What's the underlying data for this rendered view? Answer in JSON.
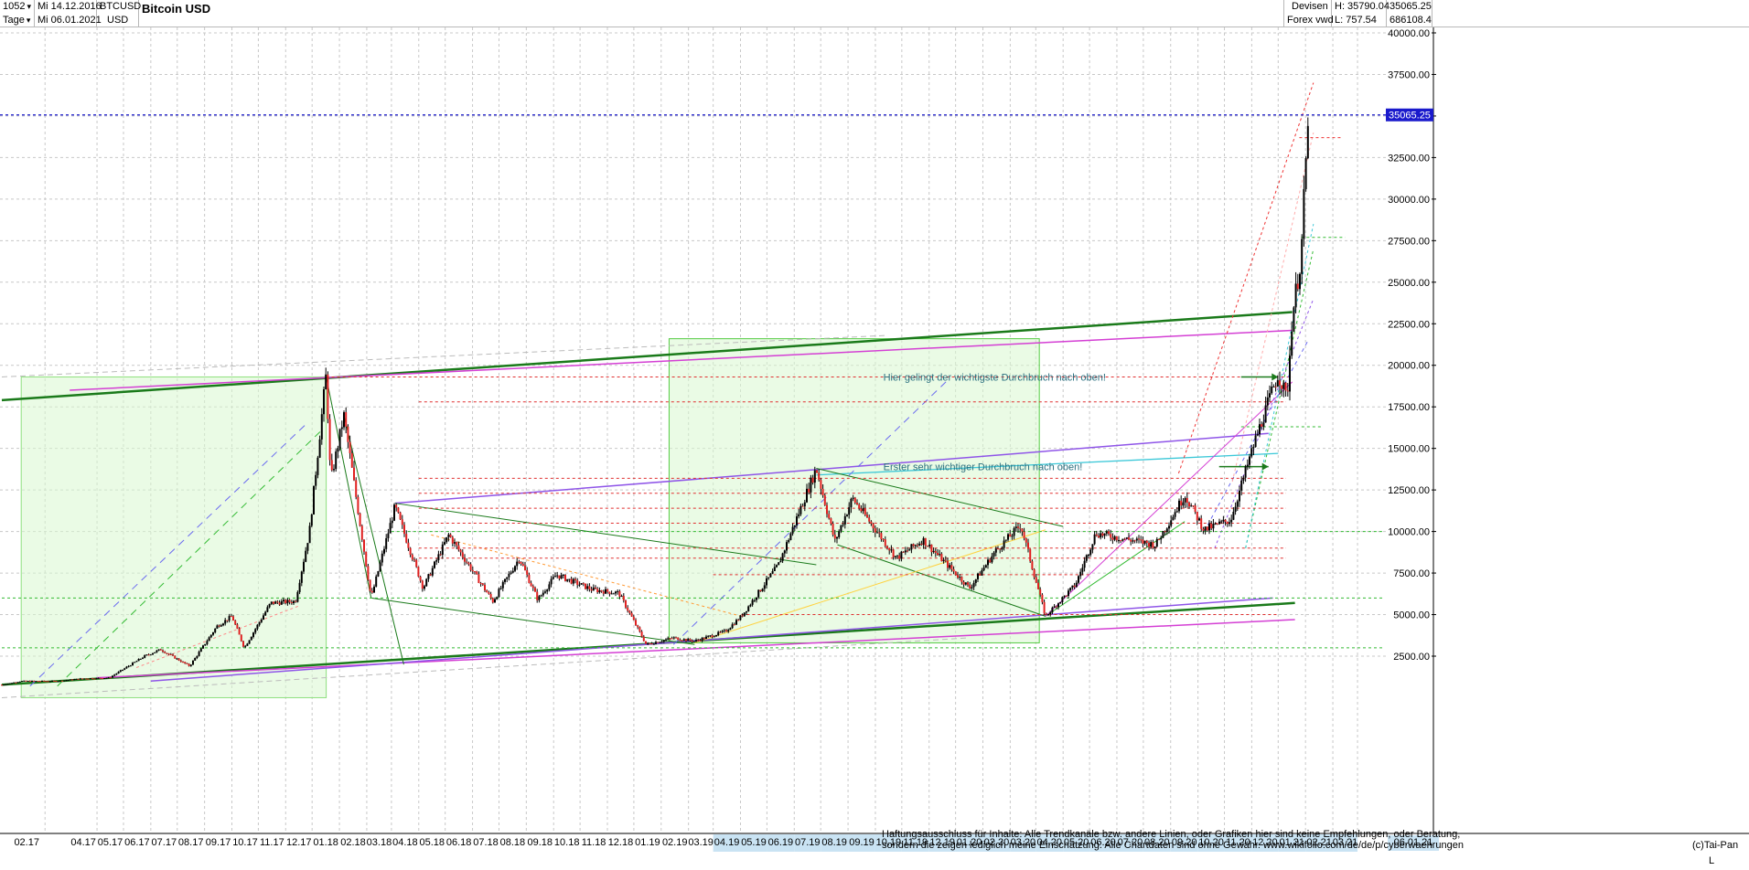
{
  "header": {
    "bars_count": "1052",
    "interval": "Tage",
    "date_from": "Mi 14.12.2016",
    "date_to": "Mi 06.01.2021",
    "symbol": "BTCUSD",
    "currency": "USD",
    "title": "Bitcoin USD",
    "market": "Devisen",
    "source": "Forex vwd",
    "high": "H: 35790.04",
    "low": "L: 757.54",
    "last": "35065.25",
    "volume": "686108.4"
  },
  "chart_data": {
    "type": "candlestick",
    "title": "Bitcoin USD",
    "ylim": [
      0,
      41000
    ],
    "y_ticks": [
      2500,
      5000,
      7500,
      10000,
      12500,
      15000,
      17500,
      20000,
      22500,
      25000,
      27500,
      30000,
      32500,
      35000,
      37500,
      40000
    ],
    "y_tick_labels": [
      "2500.00",
      "5000.00",
      "7500.00",
      "10000.00",
      "12500.00",
      "15000.00",
      "17500.00",
      "20000.00",
      "22500.00",
      "25000.00",
      "27500.00",
      "30000.00",
      "32500.00",
      "35000.00",
      "37500.00",
      "40000.00"
    ],
    "x_tick_labels": [
      "02.17",
      "04.17",
      "05.17",
      "06.17",
      "07.17",
      "08.17",
      "09.17",
      "10.17",
      "11.17",
      "12.17",
      "01.18",
      "02.18",
      "03.18",
      "04.18",
      "05.18",
      "06.18",
      "07.18",
      "08.18",
      "09.18",
      "10.18",
      "11.18",
      "12.18",
      "01.19",
      "02.19",
      "03.19",
      "04.19",
      "05.19",
      "06.19",
      "07.19",
      "08.19",
      "09.19",
      "10.19",
      "11.19",
      "12.19",
      "01.20",
      "02.20",
      "03.20",
      "04.20",
      "05.20",
      "06.20",
      "07.20",
      "08.20",
      "09.20",
      "10.20",
      "11.20",
      "12.20",
      "01.21",
      "02.21",
      "03.21"
    ],
    "last_date_label": "06.01.21",
    "last_price_label": "35065.25",
    "price_path": [
      [
        "2016-12-14",
        780
      ],
      [
        "2017-01-05",
        1000
      ],
      [
        "2017-02-15",
        1000
      ],
      [
        "2017-03-15",
        1150
      ],
      [
        "2017-04-15",
        1200
      ],
      [
        "2017-05-25",
        2500
      ],
      [
        "2017-06-12",
        2900
      ],
      [
        "2017-07-15",
        1900
      ],
      [
        "2017-08-15",
        4300
      ],
      [
        "2017-09-01",
        4900
      ],
      [
        "2017-09-15",
        3000
      ],
      [
        "2017-10-15",
        5700
      ],
      [
        "2017-11-12",
        5800
      ],
      [
        "2017-11-28",
        10000
      ],
      [
        "2017-12-17",
        19500
      ],
      [
        "2017-12-22",
        13000
      ],
      [
        "2018-01-06",
        17000
      ],
      [
        "2018-02-06",
        6000
      ],
      [
        "2018-03-05",
        11500
      ],
      [
        "2018-04-06",
        6600
      ],
      [
        "2018-05-05",
        9800
      ],
      [
        "2018-06-24",
        5800
      ],
      [
        "2018-07-24",
        8400
      ],
      [
        "2018-08-14",
        5900
      ],
      [
        "2018-09-04",
        7400
      ],
      [
        "2018-10-15",
        6500
      ],
      [
        "2018-11-14",
        6300
      ],
      [
        "2018-12-15",
        3200
      ],
      [
        "2019-01-15",
        3600
      ],
      [
        "2019-02-08",
        3400
      ],
      [
        "2019-03-15",
        4000
      ],
      [
        "2019-04-02",
        4900
      ],
      [
        "2019-05-14",
        8000
      ],
      [
        "2019-06-26",
        13800
      ],
      [
        "2019-07-17",
        9400
      ],
      [
        "2019-08-06",
        12000
      ],
      [
        "2019-09-25",
        8400
      ],
      [
        "2019-10-25",
        9500
      ],
      [
        "2019-12-17",
        6600
      ],
      [
        "2020-01-15",
        8800
      ],
      [
        "2020-02-13",
        10400
      ],
      [
        "2020-03-12",
        4900
      ],
      [
        "2020-04-15",
        6800
      ],
      [
        "2020-05-08",
        9900
      ],
      [
        "2020-07-15",
        9200
      ],
      [
        "2020-08-17",
        12200
      ],
      [
        "2020-09-08",
        10100
      ],
      [
        "2020-10-08",
        10700
      ],
      [
        "2020-11-05",
        15500
      ],
      [
        "2020-12-01",
        19500
      ],
      [
        "2020-12-11",
        18000
      ],
      [
        "2020-12-17",
        23000
      ],
      [
        "2020-12-27",
        26500
      ],
      [
        "2021-01-02",
        33000
      ],
      [
        "2021-01-06",
        35065
      ]
    ],
    "annotations": [
      {
        "text": "Hier gelingt der wichtigste Durchbruch nach oben!",
        "y": 19300
      },
      {
        "text": "Erster sehr wichtiger Durchbruch nach oben!",
        "y": 13900
      }
    ],
    "disclaimer_line1": "Haftungsausschluss für Inhalte: Alle Trendkanäle bzw. andere Linien, oder Grafiken hier sind keine Empfehlungen, oder Beratung,",
    "disclaimer_line2": "sondern die zeigen lediglich meine  Einschätzung. Alle Chartdaten sind ohne Gewähr.  www.wikifolio.com/de/de/p/cyberwaehrungen",
    "copyright": "(c)Tai-Pan",
    "axis_marker": "L"
  }
}
